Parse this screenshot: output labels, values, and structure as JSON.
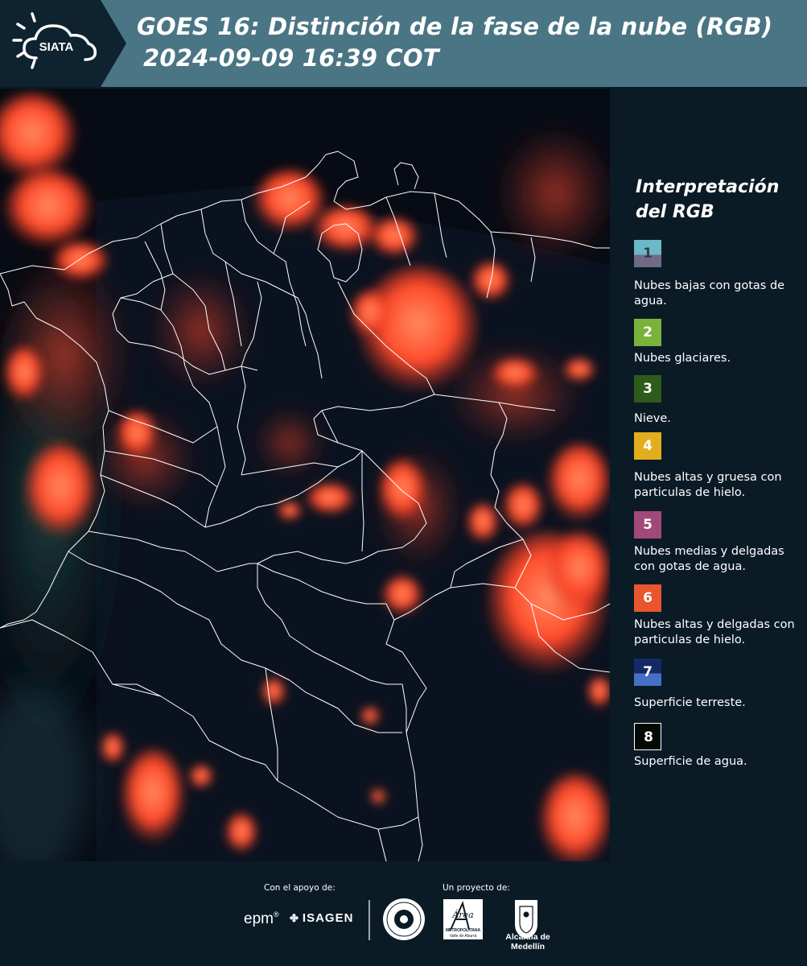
{
  "header": {
    "logo_text": "SIATA",
    "title_line1": "GOES 16: Distinción de la fase de la nube (RGB)",
    "title_line2": "2024-09-09 16:39 COT"
  },
  "legend": {
    "title": "Interpretación del RGB",
    "items": [
      {
        "number": "1",
        "label": "Nubes bajas con gotas de agua.",
        "color_top": "#6bb8c6",
        "color_bottom": "#6f6a85"
      },
      {
        "number": "2",
        "label": "Nubes glaciares.",
        "color_top": "#7ab23a",
        "color_bottom": "#7ab23a"
      },
      {
        "number": "3",
        "label": "Nieve.",
        "color_top": "#2e5a1a",
        "color_bottom": "#2e5a1a"
      },
      {
        "number": "4",
        "label": "Nubes altas y gruesa con particulas de hielo.",
        "color_top": "#e2ae1e",
        "color_bottom": "#e2ae1e"
      },
      {
        "number": "5",
        "label": "Nubes medias y delgadas con gotas de agua.",
        "color_top": "#a2487a",
        "color_bottom": "#a2487a"
      },
      {
        "number": "6",
        "label": "Nubes altas y delgadas con particulas de hielo.",
        "color_top": "#e9562e",
        "color_bottom": "#e9562e"
      },
      {
        "number": "7",
        "label": "Superficie terreste.",
        "color_top": "#142a66",
        "color_bottom": "#4670c6"
      },
      {
        "number": "8",
        "label": "Superficie de agua.",
        "color_top": "#050905",
        "color_bottom": "#050905"
      }
    ]
  },
  "footer": {
    "support_caption": "Con el apoyo de:",
    "project_caption": "Un proyecto de:",
    "sponsor_epm": "epm",
    "sponsor_isagen": "ISAGEN",
    "partner_area_top": "Área",
    "partner_area_mid": "METROPOLITANA",
    "partner_area_bot": "Valle de Aburrá",
    "partner_alcaldia": "Alcaldía de Medellín"
  },
  "colors": {
    "header_bg": "#4a7585",
    "panel_bg": "#0b1b26",
    "cloud_red": "#ff5030",
    "boundary": "#ffffff"
  }
}
